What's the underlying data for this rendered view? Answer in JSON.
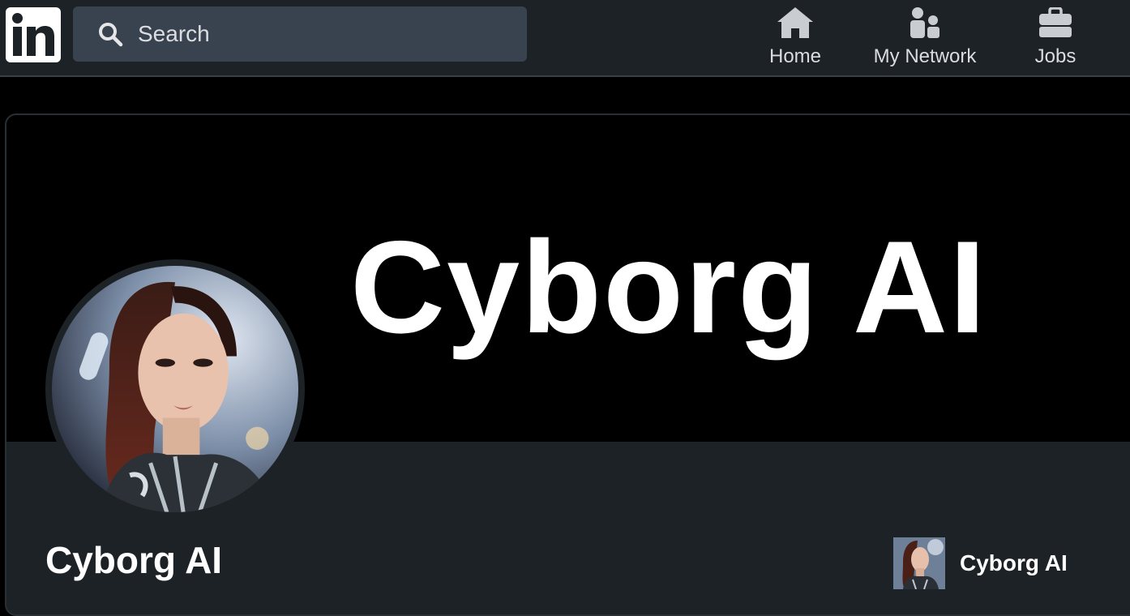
{
  "header": {
    "logo_text": "in",
    "search": {
      "placeholder": "Search",
      "value": ""
    },
    "nav": [
      {
        "label": "Home",
        "icon": "home-icon"
      },
      {
        "label": "My Network",
        "icon": "network-icon"
      },
      {
        "label": "Jobs",
        "icon": "briefcase-icon"
      }
    ]
  },
  "profile": {
    "banner_text": "Cyborg AI",
    "name": "Cyborg AI"
  },
  "side_profile": {
    "name": "Cyborg AI"
  },
  "colors": {
    "nav_bg": "#1d2226",
    "search_bg": "#38434f",
    "card_bg": "#1d2226",
    "banner_bg": "#000000",
    "text_primary": "#ffffff",
    "nav_icon": "#c9ccd0"
  }
}
